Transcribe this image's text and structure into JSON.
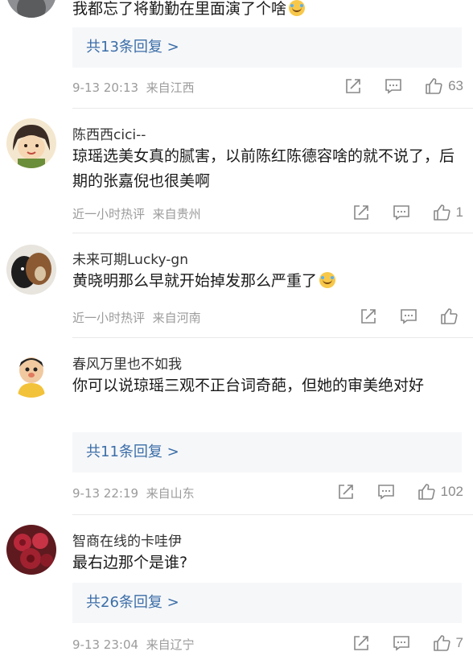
{
  "comments": [
    {
      "username": "",
      "text": "我都忘了将勤勤在里面演了个啥",
      "has_emoji": true,
      "replies": "共13条回复 >",
      "time": "9-13 20:13",
      "location": "来自江西",
      "likes": "63"
    },
    {
      "username": "陈西西cici--",
      "text": "琼瑶选美女真的腻害，以前陈红陈德容啥的就不说了，后期的张嘉倪也很美啊",
      "time": "近一小时热评",
      "location": "来自贵州",
      "likes": "1"
    },
    {
      "username": "未来可期Lucky-gn",
      "text": "黄晓明那么早就开始掉发那么严重了",
      "has_emoji": true,
      "time": "近一小时热评",
      "location": "来自河南",
      "likes": ""
    },
    {
      "username": "春风万里也不如我",
      "text": "你可以说琼瑶三观不正台词奇葩，但她的审美绝对好",
      "replies": "共11条回复 >",
      "time": "9-13 22:19",
      "location": "来自山东",
      "likes": "102"
    },
    {
      "username": "智商在线的卡哇伊",
      "text": "最右边那个是谁?",
      "replies": "共26条回复 >",
      "time": "9-13 23:04",
      "location": "来自辽宁",
      "likes": "7"
    }
  ],
  "icons": {
    "share": "share-icon",
    "comment": "comment-icon",
    "like": "thumbs-up-icon"
  },
  "colors": {
    "link": "#3b6ea8",
    "meta": "#9b9b9b",
    "reply_bg": "#f6f7f9"
  }
}
